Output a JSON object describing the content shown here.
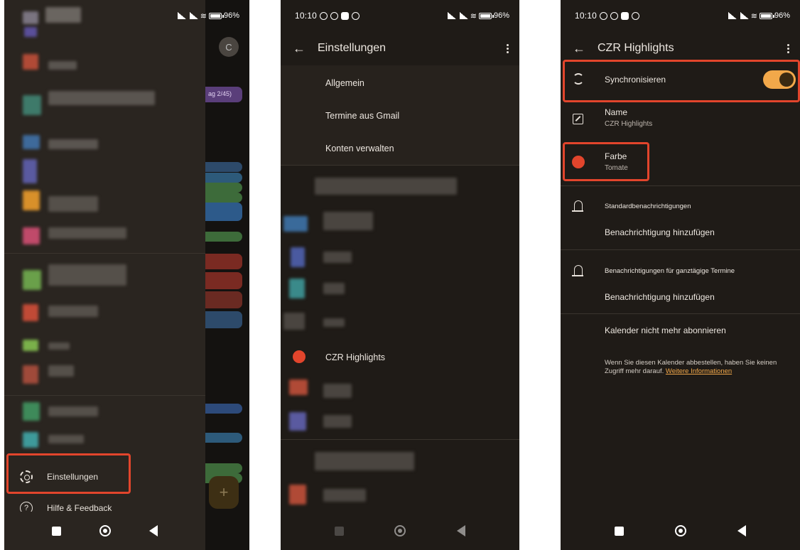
{
  "status": {
    "time": "10:10",
    "battery": "96"
  },
  "screen1": {
    "avatar_letter": "C",
    "settings_label": "Einstellungen",
    "help_label": "Hilfe & Feedback",
    "fab_label": "+",
    "pill_text": "ag 2/45)"
  },
  "screen2": {
    "title": "Einstellungen",
    "items": [
      "Allgemein",
      "Termine aus Gmail",
      "Konten verwalten"
    ],
    "calendar_name": "CZR Highlights",
    "calendar_color": "#e2452c"
  },
  "screen3": {
    "title": "CZR Highlights",
    "sync_label": "Synchronisieren",
    "sync_on": true,
    "name_label": "Name",
    "name_value": "CZR Highlights",
    "color_label": "Farbe",
    "color_value": "Tomate",
    "color_hex": "#e2452c",
    "section_default": "Standardbenachrichtigungen",
    "add_notification_1": "Benachrichtigung hinzufügen",
    "section_allday": "Benachrichtigungen für ganztägige Termine",
    "add_notification_2": "Benachrichtigung hinzufügen",
    "unsubscribe_label": "Kalender nicht mehr abonnieren",
    "info_text": "Wenn Sie diesen Kalender abbestellen, haben Sie keinen Zugriff mehr darauf.",
    "info_link": "Weitere Informationen"
  },
  "colors": {
    "accent": "#f2a84a",
    "highlight": "#e2452c",
    "background": "#1f1b17"
  }
}
